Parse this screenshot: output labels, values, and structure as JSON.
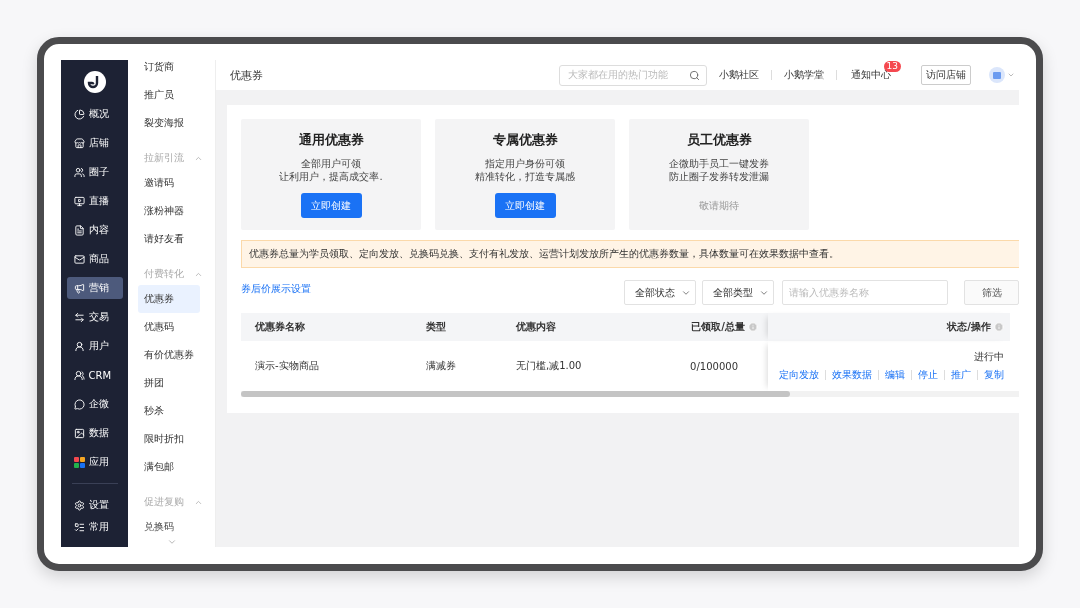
{
  "nav": {
    "items": [
      {
        "label": "概况",
        "selected": false
      },
      {
        "label": "店铺",
        "selected": false
      },
      {
        "label": "圈子",
        "selected": false
      },
      {
        "label": "直播",
        "selected": false
      },
      {
        "label": "内容",
        "selected": false
      },
      {
        "label": "商品",
        "selected": false
      },
      {
        "label": "营销",
        "selected": true
      },
      {
        "label": "交易",
        "selected": false
      },
      {
        "label": "用户",
        "selected": false
      },
      {
        "label": "CRM",
        "selected": false
      },
      {
        "label": "企微",
        "selected": false
      },
      {
        "label": "数据",
        "selected": false
      },
      {
        "label": "应用",
        "selected": false
      }
    ],
    "bottom_items": [
      {
        "label": "设置"
      },
      {
        "label": "常用"
      }
    ]
  },
  "subnav": {
    "items": [
      {
        "kind": "link",
        "label": "订货商",
        "selected": false
      },
      {
        "kind": "link",
        "label": "推广员",
        "selected": false
      },
      {
        "kind": "link",
        "label": "裂变海报",
        "selected": false
      },
      {
        "kind": "group",
        "label": "拉新引流",
        "expanded": true
      },
      {
        "kind": "link",
        "label": "邀请码",
        "selected": false
      },
      {
        "kind": "link",
        "label": "涨粉神器",
        "selected": false
      },
      {
        "kind": "link",
        "label": "请好友看",
        "selected": false
      },
      {
        "kind": "group",
        "label": "付费转化",
        "expanded": true
      },
      {
        "kind": "link",
        "label": "优惠券",
        "selected": true
      },
      {
        "kind": "link",
        "label": "优惠码",
        "selected": false
      },
      {
        "kind": "link",
        "label": "有价优惠券",
        "selected": false
      },
      {
        "kind": "link",
        "label": "拼团",
        "selected": false
      },
      {
        "kind": "link",
        "label": "秒杀",
        "selected": false
      },
      {
        "kind": "link",
        "label": "限时折扣",
        "selected": false
      },
      {
        "kind": "link",
        "label": "满包邮",
        "selected": false
      },
      {
        "kind": "group",
        "label": "促进复购",
        "expanded": true
      },
      {
        "kind": "link",
        "label": "兑换码",
        "selected": false
      }
    ]
  },
  "header": {
    "title": "优惠券",
    "search": {
      "placeholder": "大家都在用的热门功能"
    },
    "links": [
      "小鹅社区",
      "小鹅学堂"
    ],
    "notifications": {
      "label": "通知中心",
      "badge": "13"
    },
    "visit_button": "访问店铺"
  },
  "cards": [
    {
      "title": "通用优惠券",
      "lines": [
        "全部用户可领",
        "让利用户，提高成交率."
      ],
      "action": {
        "kind": "button",
        "label": "立即创建"
      }
    },
    {
      "title": "专属优惠券",
      "lines": [
        "指定用户身份可领",
        "精准转化，打造专属感"
      ],
      "action": {
        "kind": "button",
        "label": "立即创建"
      }
    },
    {
      "title": "员工优惠券",
      "lines": [
        "企微助手员工一键发券",
        "防止圈子发券转发泄漏"
      ],
      "action": {
        "kind": "text",
        "label": "敬请期待"
      }
    }
  ],
  "notice": "优惠券总量为学员领取、定向发放、兑换码兑换、支付有礼发放、运营计划发放所产生的优惠券数量，具体数量可在效果数据中查看。",
  "settings_link": "券后价展示设置",
  "filters": {
    "status": "全部状态",
    "type": "全部类型",
    "search": {
      "placeholder": "请输入优惠券名称"
    },
    "button": "筛选"
  },
  "table": {
    "columns": [
      "优惠券名称",
      "类型",
      "优惠内容",
      "已领取/总量",
      "状态/操作"
    ],
    "rows": [
      {
        "name": "演示-实物商品",
        "type": "满减券",
        "content": "无门槛,减1.00",
        "claimed": "0/100000",
        "status": "进行中",
        "actions": [
          "定向发放",
          "效果数据",
          "编辑",
          "停止",
          "推广",
          "复制"
        ]
      }
    ]
  }
}
